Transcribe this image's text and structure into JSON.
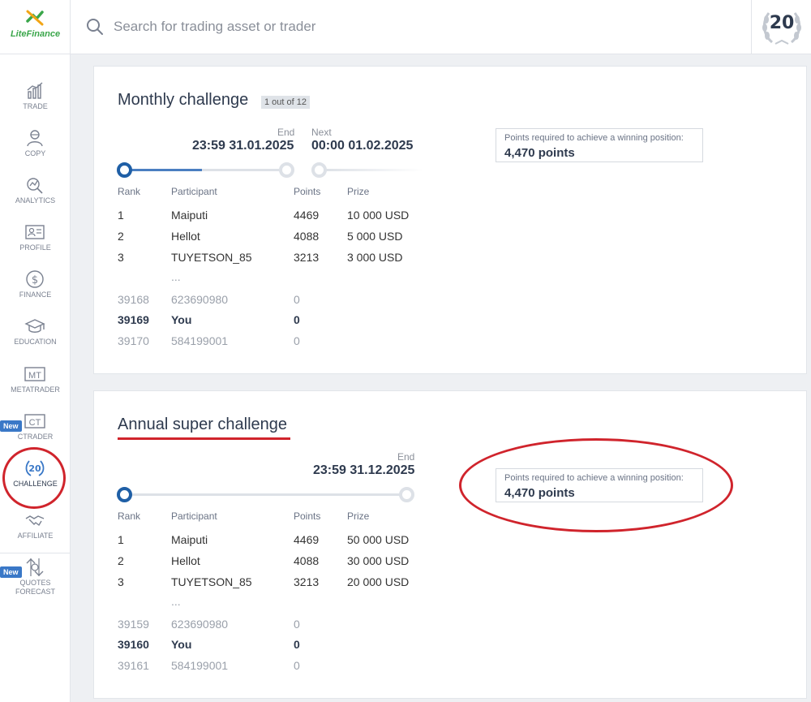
{
  "app": {
    "logo_text": "LiteFinance",
    "anniversary_badge": "20"
  },
  "search": {
    "placeholder": "Search for trading asset or trader"
  },
  "sidebar": {
    "items": [
      {
        "label": "TRADE",
        "icon": "chart-bars-icon"
      },
      {
        "label": "COPY",
        "icon": "trader-icon"
      },
      {
        "label": "ANALYTICS",
        "icon": "analytics-icon"
      },
      {
        "label": "PROFILE",
        "icon": "profile-card-icon"
      },
      {
        "label": "FINANCE",
        "icon": "dollar-icon"
      },
      {
        "label": "EDUCATION",
        "icon": "graduation-cap-icon"
      },
      {
        "label": "METATRADER",
        "icon": "mt-icon",
        "icon_text": "MT"
      },
      {
        "label": "CTRADER",
        "icon": "ct-icon",
        "icon_text": "CT",
        "badge": "New"
      },
      {
        "label": "CHALLENGE",
        "icon": "laurel-20-icon",
        "icon_text": "20",
        "active": true
      },
      {
        "label": "AFFILIATE",
        "icon": "handshake-icon"
      },
      {
        "label": "QUOTES FORECAST",
        "icon": "quotes-forecast-icon",
        "badge": "New"
      }
    ]
  },
  "monthly": {
    "title": "Monthly challenge",
    "counter": "1 out of 12",
    "end_label": "End",
    "end_date": "23:59 31.01.2025",
    "next_label": "Next",
    "next_date": "00:00 01.02.2025",
    "progress": 0.5,
    "points_label": "Points required to achieve a winning position:",
    "points_value": "4,470 points",
    "headers": {
      "rank": "Rank",
      "participant": "Participant",
      "points": "Points",
      "prize": "Prize"
    },
    "top_rows": [
      {
        "rank": "1",
        "participant": "Maiputi",
        "points": "4469",
        "prize": "10 000 USD"
      },
      {
        "rank": "2",
        "participant": "Hellot",
        "points": "4088",
        "prize": "5 000 USD"
      },
      {
        "rank": "3",
        "participant": "TUYETSON_85",
        "points": "3213",
        "prize": "3 000 USD"
      }
    ],
    "ellipsis": "...",
    "bottom_rows": [
      {
        "rank": "39168",
        "participant": "623690980",
        "points": "0"
      },
      {
        "rank": "39169",
        "participant": "You",
        "points": "0"
      },
      {
        "rank": "39170",
        "participant": "584199001",
        "points": "0"
      }
    ]
  },
  "annual": {
    "title": "Annual super challenge",
    "end_label": "End",
    "end_date": "23:59 31.12.2025",
    "progress": 0.0,
    "points_label": "Points required to achieve a winning position:",
    "points_value": "4,470 points",
    "headers": {
      "rank": "Rank",
      "participant": "Participant",
      "points": "Points",
      "prize": "Prize"
    },
    "top_rows": [
      {
        "rank": "1",
        "participant": "Maiputi",
        "points": "4469",
        "prize": "50 000 USD"
      },
      {
        "rank": "2",
        "participant": "Hellot",
        "points": "4088",
        "prize": "30 000 USD"
      },
      {
        "rank": "3",
        "participant": "TUYETSON_85",
        "points": "3213",
        "prize": "20 000 USD"
      }
    ],
    "ellipsis": "...",
    "bottom_rows": [
      {
        "rank": "39159",
        "participant": "623690980",
        "points": "0"
      },
      {
        "rank": "39160",
        "participant": "You",
        "points": "0"
      },
      {
        "rank": "39161",
        "participant": "584199001",
        "points": "0"
      }
    ]
  },
  "colors": {
    "brand_green": "#3aa64a",
    "accent_blue": "#1f5fa6",
    "annotation_red": "#d0242c"
  }
}
